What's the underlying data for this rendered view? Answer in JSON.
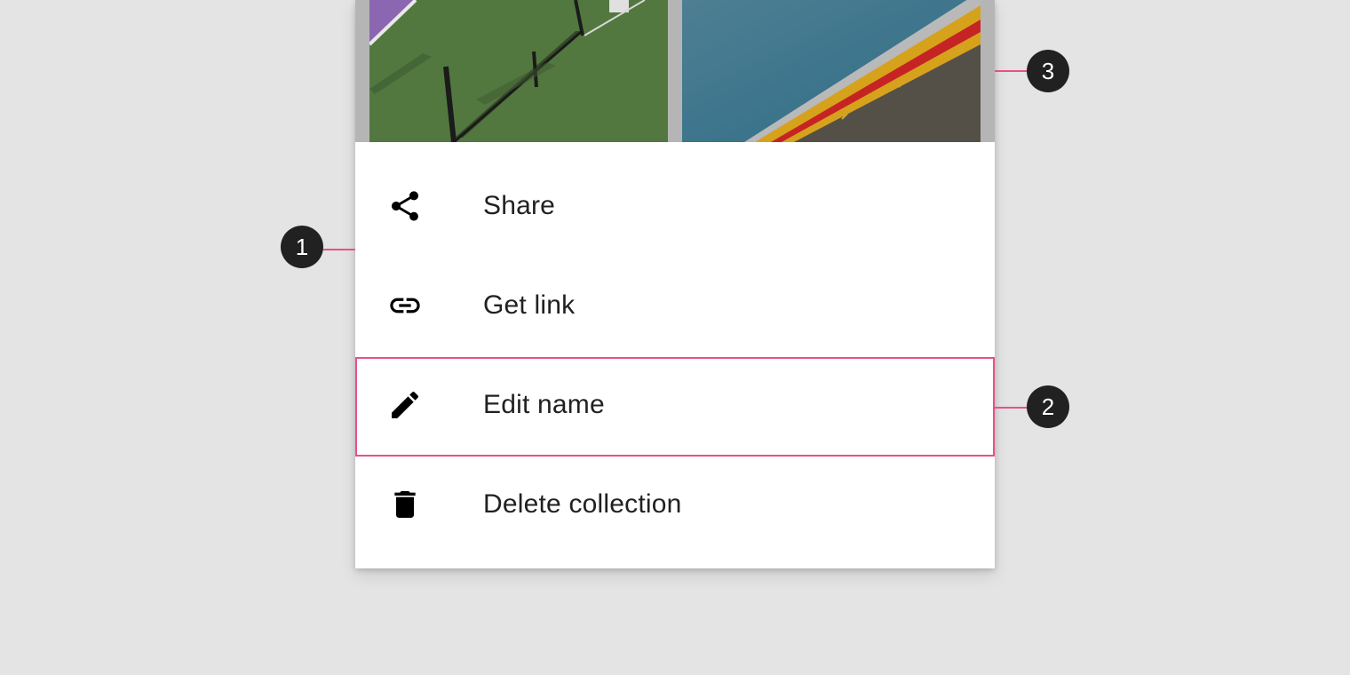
{
  "menu": {
    "items": [
      {
        "icon": "share-icon",
        "label": "Share"
      },
      {
        "icon": "link-icon",
        "label": "Get link"
      },
      {
        "icon": "pencil-icon",
        "label": "Edit name"
      },
      {
        "icon": "trash-icon",
        "label": "Delete collection"
      }
    ]
  },
  "callouts": [
    {
      "number": "1"
    },
    {
      "number": "2"
    },
    {
      "number": "3"
    }
  ],
  "colors": {
    "background": "#e4e4e4",
    "sheet": "#ffffff",
    "callout_accent": "#e8508a",
    "badge": "#212121",
    "text": "#212121"
  }
}
